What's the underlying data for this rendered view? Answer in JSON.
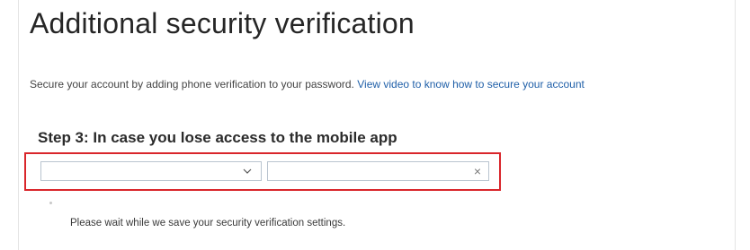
{
  "page": {
    "title": "Additional security verification",
    "intro_text": "Secure your account by adding phone verification to your password.",
    "intro_link": "View video to know how to secure your account"
  },
  "step": {
    "heading": "Step 3: In case you lose access to the mobile app",
    "country_select": {
      "selected_value": "",
      "icon": "chevron-down-icon"
    },
    "phone_input": {
      "value": "",
      "clear_glyph": "×"
    },
    "highlight_color": "#d9262b"
  },
  "status": {
    "message": "Please wait while we save your security verification settings."
  },
  "colors": {
    "link": "#1f5fa8",
    "title": "#262626"
  }
}
